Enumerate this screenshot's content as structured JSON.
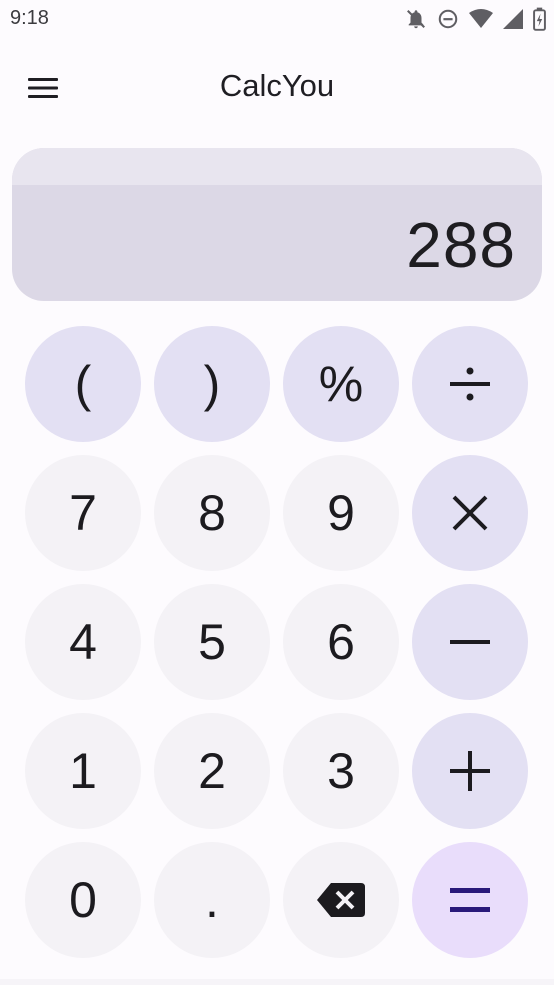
{
  "status": {
    "time": "9:18",
    "icons": [
      "notifications-off-icon",
      "do-not-disturb-icon",
      "wifi-icon",
      "signal-icon",
      "battery-icon"
    ]
  },
  "app_bar": {
    "title": "CalcYou",
    "menu_icon": "hamburger-menu-icon"
  },
  "display": {
    "value": "288"
  },
  "keypad": {
    "open_paren": "(",
    "close_paren": ")",
    "percent": "%",
    "divide_icon": "divide-icon",
    "seven": "7",
    "eight": "8",
    "nine": "9",
    "multiply_icon": "multiply-icon",
    "four": "4",
    "five": "5",
    "six": "6",
    "minus_icon": "minus-icon",
    "one": "1",
    "two": "2",
    "three": "3",
    "plus_icon": "plus-icon",
    "zero": "0",
    "decimal": ".",
    "backspace_icon": "backspace-icon",
    "equals_icon": "equals-icon"
  },
  "colors": {
    "digit_key": "#f4f2f6",
    "operator_key": "#e3e0f3",
    "equals_key": "#e9ddfb",
    "equals_glyph": "#2a1a7a",
    "display_background": "#dcd8e6",
    "app_background": "#fdfbfe"
  }
}
